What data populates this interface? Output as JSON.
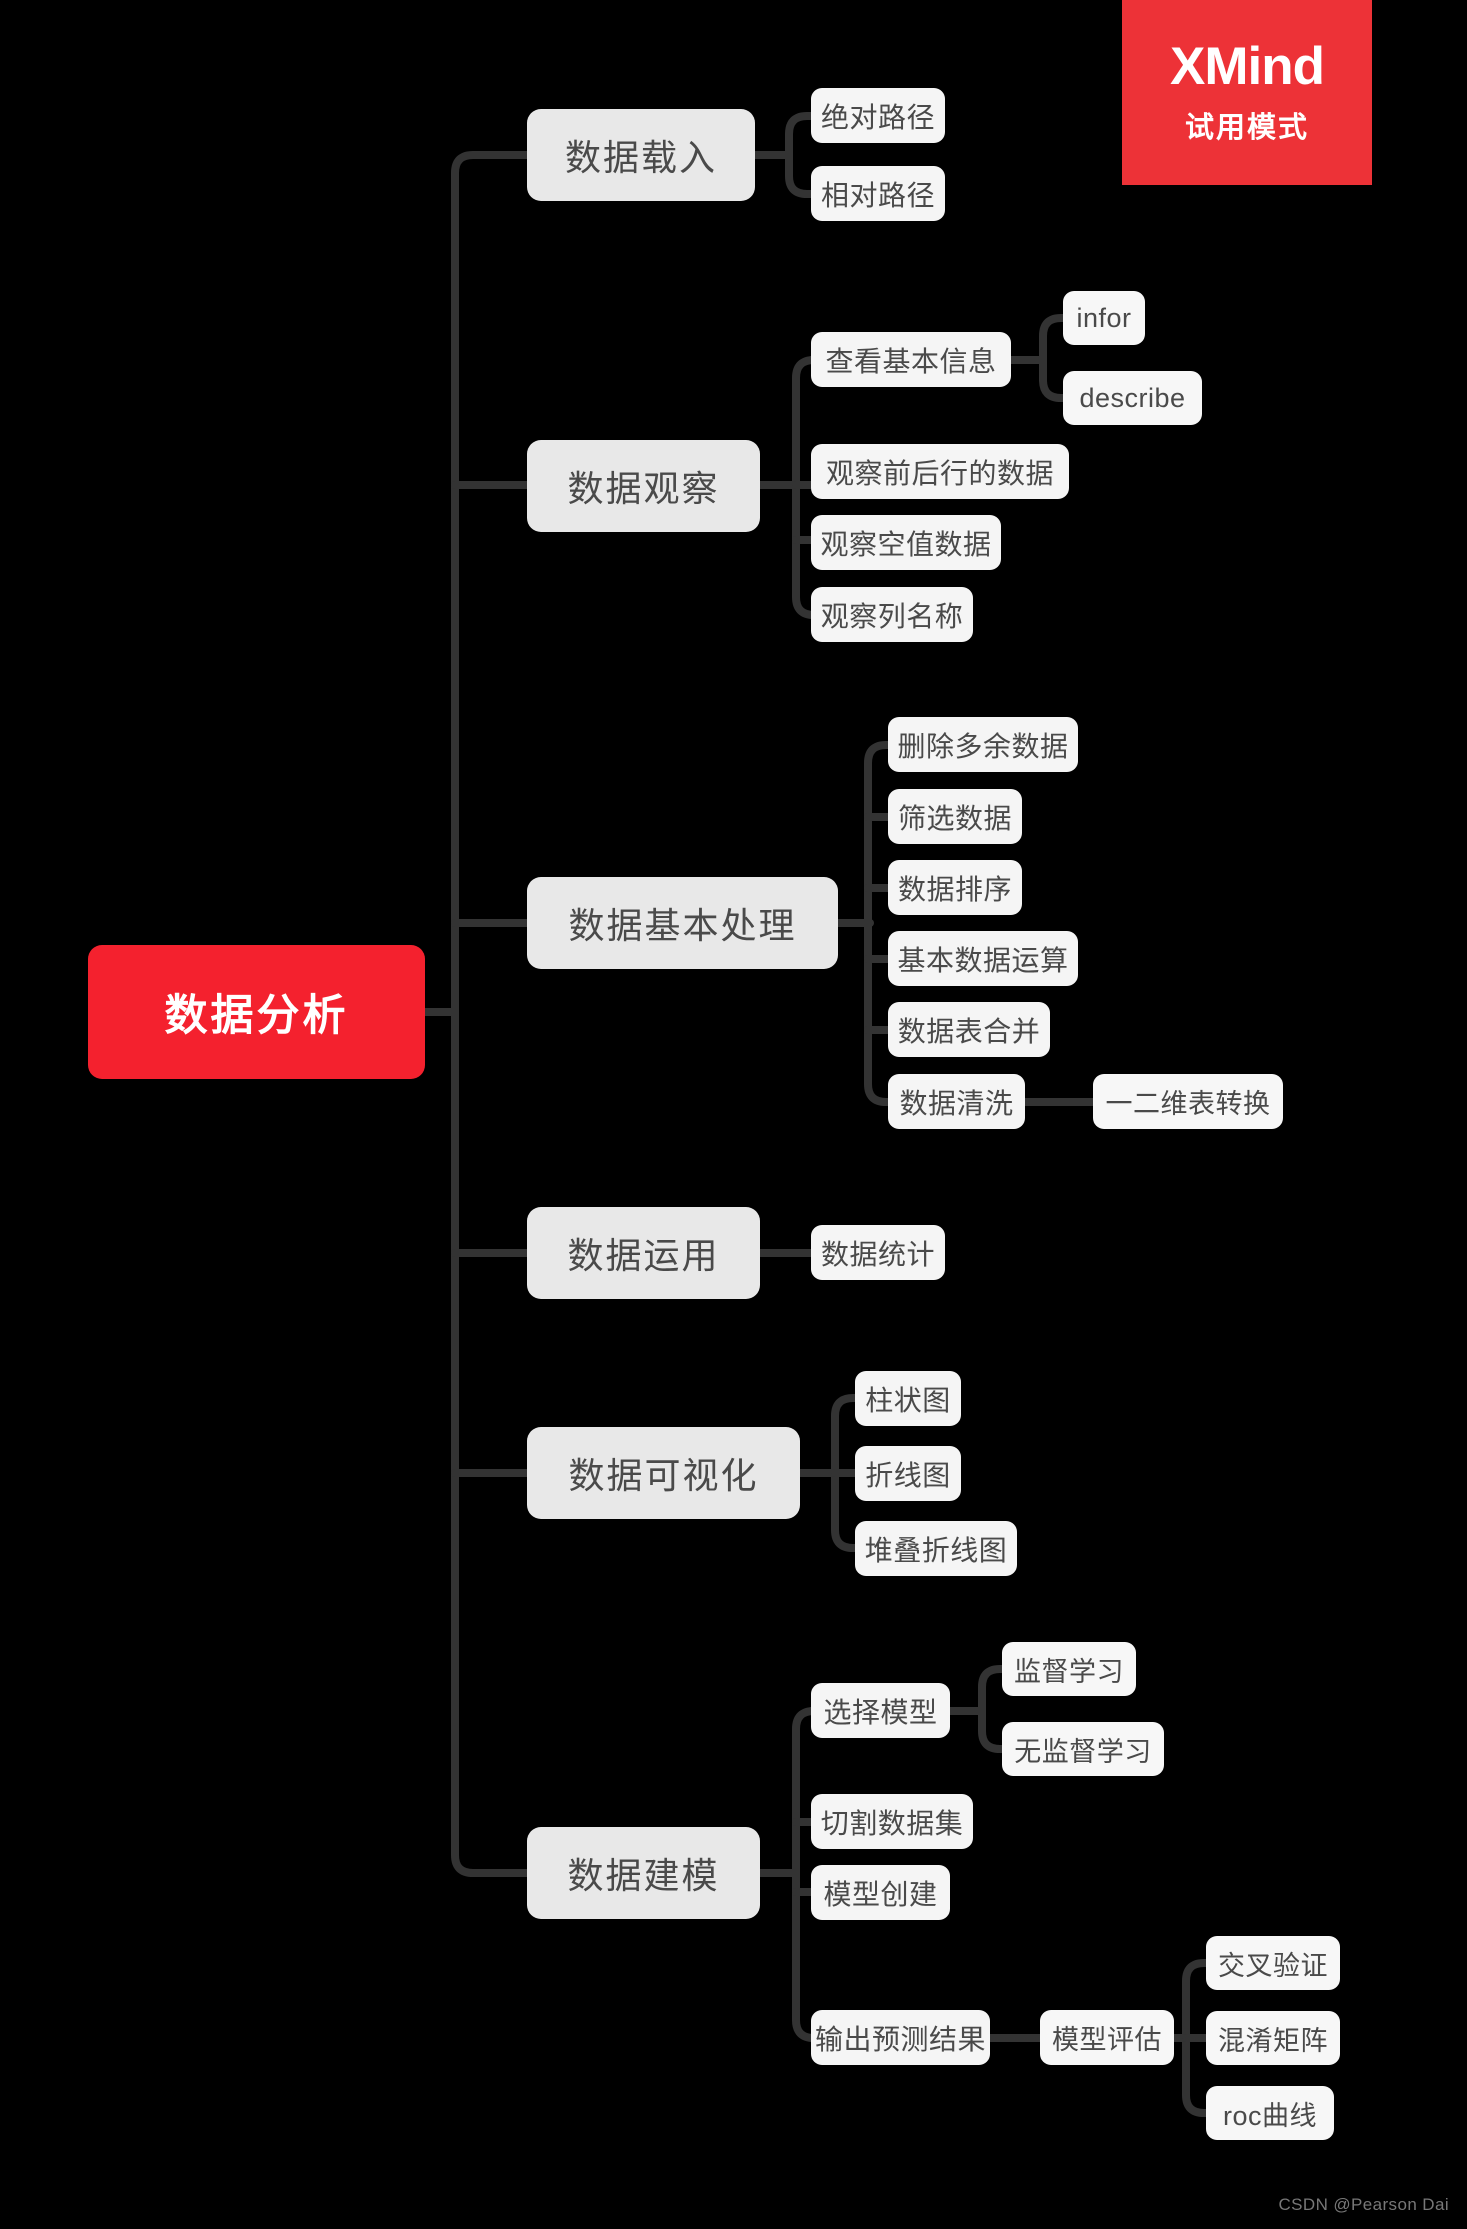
{
  "app": {
    "name": "XMind",
    "trial_badge_title": "XMind",
    "trial_badge_subtitle": "试用模式",
    "badge_color": "#ed3237"
  },
  "watermark": {
    "text": "CSDN @Pearson Dai"
  },
  "canvas": {
    "background": "#000000",
    "link_color": "#333333",
    "root_color": "#f4212e",
    "level1_color": "#e8e8e8",
    "level2_color": "#f5f5f5",
    "text_color": "#4a4a4a"
  },
  "mindmap": {
    "root": "数据分析",
    "branches": [
      {
        "label": "数据载入",
        "children": [
          {
            "label": "绝对路径",
            "children": []
          },
          {
            "label": "相对路径",
            "children": []
          }
        ]
      },
      {
        "label": "数据观察",
        "children": [
          {
            "label": "查看基本信息",
            "children": [
              {
                "label": "infor"
              },
              {
                "label": "describe"
              }
            ]
          },
          {
            "label": "观察前后行的数据",
            "children": []
          },
          {
            "label": "观察空值数据",
            "children": []
          },
          {
            "label": "观察列名称",
            "children": []
          }
        ]
      },
      {
        "label": "数据基本处理",
        "children": [
          {
            "label": "删除多余数据",
            "children": []
          },
          {
            "label": "筛选数据",
            "children": []
          },
          {
            "label": "数据排序",
            "children": []
          },
          {
            "label": "基本数据运算",
            "children": []
          },
          {
            "label": "数据表合并",
            "children": []
          },
          {
            "label": "数据清洗",
            "children": [
              {
                "label": "一二维表转换"
              }
            ]
          }
        ]
      },
      {
        "label": "数据运用",
        "children": [
          {
            "label": "数据统计",
            "children": []
          }
        ]
      },
      {
        "label": "数据可视化",
        "children": [
          {
            "label": "柱状图",
            "children": []
          },
          {
            "label": "折线图",
            "children": []
          },
          {
            "label": "堆叠折线图",
            "children": []
          }
        ]
      },
      {
        "label": "数据建模",
        "children": [
          {
            "label": "选择模型",
            "children": [
              {
                "label": "监督学习"
              },
              {
                "label": "无监督学习"
              }
            ]
          },
          {
            "label": "切割数据集",
            "children": []
          },
          {
            "label": "模型创建",
            "children": []
          },
          {
            "label": "输出预测结果",
            "children": [
              {
                "label": "模型评估",
                "children": [
                  {
                    "label": "交叉验证"
                  },
                  {
                    "label": "混淆矩阵"
                  },
                  {
                    "label": "roc曲线"
                  }
                ]
              }
            ]
          }
        ]
      }
    ]
  },
  "nodes": {
    "root": {
      "text": "数据分析"
    },
    "b0": {
      "text": "数据载入"
    },
    "b0c0": {
      "text": "绝对路径"
    },
    "b0c1": {
      "text": "相对路径"
    },
    "b1": {
      "text": "数据观察"
    },
    "b1c0": {
      "text": "查看基本信息"
    },
    "b1c0g0": {
      "text": "infor"
    },
    "b1c0g1": {
      "text": "describe"
    },
    "b1c1": {
      "text": "观察前后行的数据"
    },
    "b1c2": {
      "text": "观察空值数据"
    },
    "b1c3": {
      "text": "观察列名称"
    },
    "b2": {
      "text": "数据基本处理"
    },
    "b2c0": {
      "text": "删除多余数据"
    },
    "b2c1": {
      "text": "筛选数据"
    },
    "b2c2": {
      "text": "数据排序"
    },
    "b2c3": {
      "text": "基本数据运算"
    },
    "b2c4": {
      "text": "数据表合并"
    },
    "b2c5": {
      "text": "数据清洗"
    },
    "b2c5g0": {
      "text": "一二维表转换"
    },
    "b3": {
      "text": "数据运用"
    },
    "b3c0": {
      "text": "数据统计"
    },
    "b4": {
      "text": "数据可视化"
    },
    "b4c0": {
      "text": "柱状图"
    },
    "b4c1": {
      "text": "折线图"
    },
    "b4c2": {
      "text": "堆叠折线图"
    },
    "b5": {
      "text": "数据建模"
    },
    "b5c0": {
      "text": "选择模型"
    },
    "b5c0g0": {
      "text": "监督学习"
    },
    "b5c0g1": {
      "text": "无监督学习"
    },
    "b5c1": {
      "text": "切割数据集"
    },
    "b5c2": {
      "text": "模型创建"
    },
    "b5c3": {
      "text": "输出预测结果"
    },
    "b5c3g0": {
      "text": "模型评估"
    },
    "b5c3g0h0": {
      "text": "交叉验证"
    },
    "b5c3g0h1": {
      "text": "混淆矩阵"
    },
    "b5c3g0h2": {
      "text": "roc曲线"
    }
  }
}
